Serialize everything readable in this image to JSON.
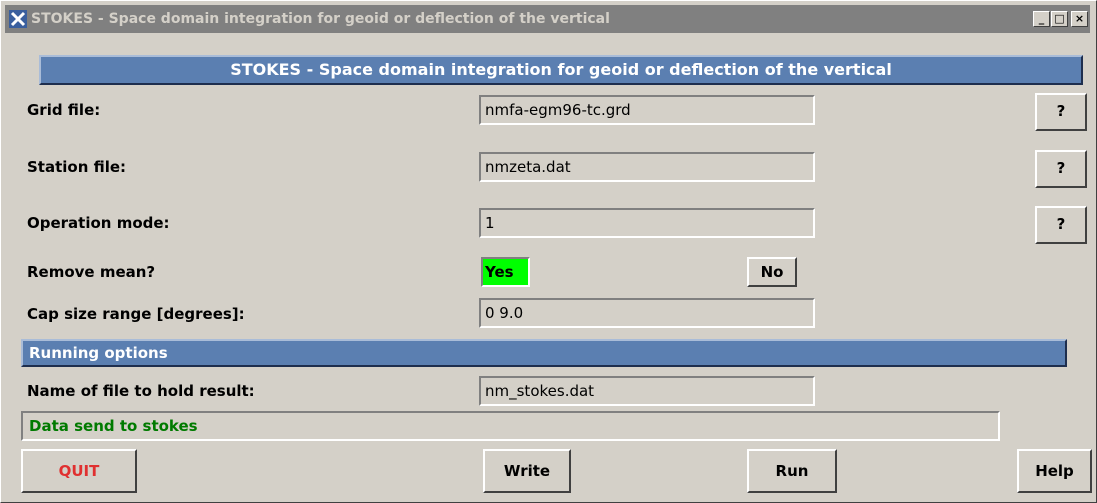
{
  "window": {
    "title": "STOKES - Space domain integration for geoid or deflection of the vertical",
    "minimize": "_",
    "maximize": "□",
    "close": "×"
  },
  "header": "STOKES - Space domain integration for geoid or deflection of the vertical",
  "form": {
    "grid_file_label": "Grid file:",
    "grid_file_value": "nmfa-egm96-tc.grd",
    "station_file_label": "Station file:",
    "station_file_value": "nmzeta.dat",
    "operation_mode_label": "Operation mode:",
    "operation_mode_value": "1",
    "remove_mean_label": "Remove mean?",
    "remove_mean_yes": "Yes",
    "remove_mean_no": "No",
    "cap_size_label": "Cap size range [degrees]:",
    "cap_size_value": "0 9.0",
    "help_q": "?"
  },
  "running_options": {
    "title": "Running options",
    "result_file_label": "Name of file to hold result:",
    "result_file_value": "nm_stokes.dat"
  },
  "status": "Data send to stokes",
  "buttons": {
    "quit": "QUIT",
    "write": "Write",
    "run": "Run",
    "help": "Help"
  },
  "colors": {
    "header_blue": "#5b7fb1",
    "yes_green": "#00ff00",
    "quit_red": "#e03030",
    "status_green": "#007a00"
  }
}
